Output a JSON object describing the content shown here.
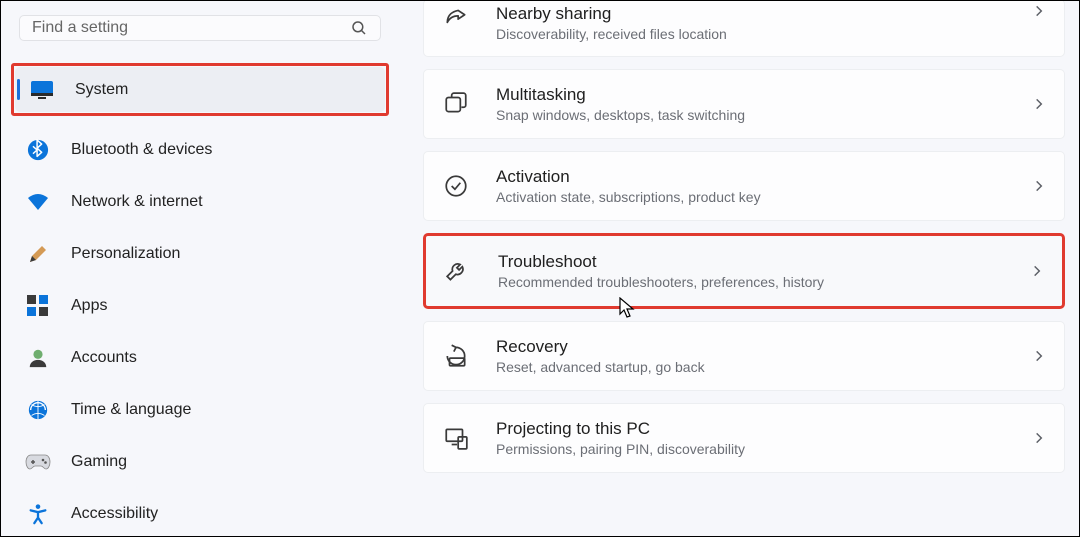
{
  "search": {
    "placeholder": "Find a setting"
  },
  "sidebar": {
    "items": [
      {
        "label": "System"
      },
      {
        "label": "Bluetooth & devices"
      },
      {
        "label": "Network & internet"
      },
      {
        "label": "Personalization"
      },
      {
        "label": "Apps"
      },
      {
        "label": "Accounts"
      },
      {
        "label": "Time & language"
      },
      {
        "label": "Gaming"
      },
      {
        "label": "Accessibility"
      }
    ]
  },
  "main": {
    "items": [
      {
        "title": "Nearby sharing",
        "desc": "Discoverability, received files location"
      },
      {
        "title": "Multitasking",
        "desc": "Snap windows, desktops, task switching"
      },
      {
        "title": "Activation",
        "desc": "Activation state, subscriptions, product key"
      },
      {
        "title": "Troubleshoot",
        "desc": "Recommended troubleshooters, preferences, history"
      },
      {
        "title": "Recovery",
        "desc": "Reset, advanced startup, go back"
      },
      {
        "title": "Projecting to this PC",
        "desc": "Permissions, pairing PIN, discoverability"
      }
    ]
  }
}
